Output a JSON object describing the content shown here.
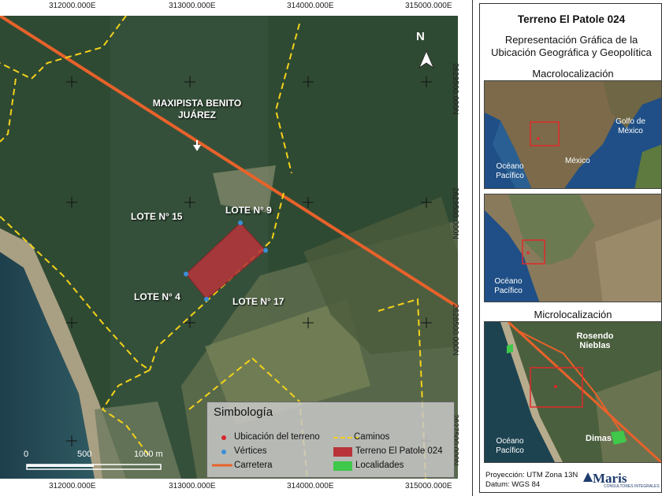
{
  "map": {
    "coords_top": [
      "312000.000E",
      "313000.000E",
      "314000.000E",
      "315000.000E"
    ],
    "coords_bottom": [
      "312000.000E",
      "313000.000E",
      "314000.000E",
      "315000.000E"
    ],
    "coords_right": [
      "2629500.000N",
      "2629500.000N",
      "2628500.000N",
      "2627500.000N"
    ],
    "north": "N",
    "road_label": "MAXIPISTA BENITO JUÁREZ",
    "lots": [
      "LOTE N° 15",
      "LOTE N° 9",
      "LOTE N° 4",
      "LOTE N° 17"
    ],
    "scale": {
      "labels": [
        "0",
        "500",
        "1000 m"
      ]
    }
  },
  "legend": {
    "title": "Simbología",
    "items": [
      {
        "label": "Ubicación del terreno",
        "symbol": "red-dot"
      },
      {
        "label": "Caminos",
        "symbol": "yellow-dashed-line"
      },
      {
        "label": "Vértices",
        "symbol": "blue-dot"
      },
      {
        "label": "Terreno El Patole 024",
        "symbol": "red-polygon"
      },
      {
        "label": "Carretera",
        "symbol": "orange-line"
      },
      {
        "label": "Localidades",
        "symbol": "green-polygon"
      }
    ]
  },
  "panel": {
    "title": "Terreno El Patole 024",
    "subtitle_1": "Representación Gráfica de la",
    "subtitle_2": "Ubicación Geográfica y Geopolítica",
    "macro_heading": "Macrolocalización",
    "macro_labels": {
      "gulf": "Golfo de México",
      "country": "México",
      "ocean": "Océano Pacífico"
    },
    "mid_labels": {
      "ocean": "Océano Pacífico"
    },
    "micro_heading": "Microlocalización",
    "micro_labels": {
      "town1": "Rosendo Nieblas",
      "town2": "Dimas",
      "ocean": "Océano Pacífico"
    },
    "projection": "Proyección: UTM Zona 13N",
    "datum": "Datum:  WGS 84",
    "logo": "Maris",
    "logo_sub": "CONSULTORES INTEGRALES"
  },
  "colors": {
    "road": "#e8622a",
    "paths": "#f3d21a",
    "parcel": "#b8343a",
    "vertex": "#3a8fd8",
    "locality": "#3fc84a"
  }
}
